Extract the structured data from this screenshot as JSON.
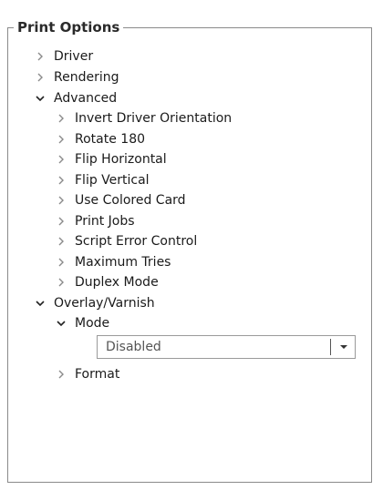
{
  "group": {
    "title": "Print Options"
  },
  "tree": {
    "driver": "Driver",
    "rendering": "Rendering",
    "advanced": "Advanced",
    "advanced_items": {
      "invert_driver_orientation": "Invert Driver Orientation",
      "rotate_180": "Rotate 180",
      "flip_horizontal": "Flip Horizontal",
      "flip_vertical": "Flip Vertical",
      "use_colored_card": "Use Colored Card",
      "print_jobs": "Print Jobs",
      "script_error_control": "Script Error Control",
      "maximum_tries": "Maximum Tries",
      "duplex_mode": "Duplex Mode"
    },
    "overlay_varnish": "Overlay/Varnish",
    "mode": "Mode",
    "mode_value": "Disabled",
    "format": "Format"
  },
  "icons": {
    "collapsed": "chevron-right-icon",
    "expanded": "chevron-down-icon",
    "dropdown": "caret-down-icon"
  }
}
